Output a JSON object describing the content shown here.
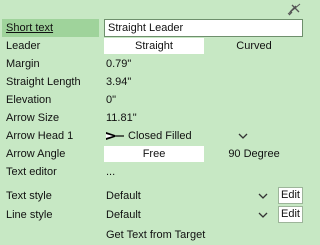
{
  "rows": {
    "short_text": {
      "label": "Short text",
      "value": "Straight Leader"
    },
    "leader": {
      "label": "Leader",
      "options": [
        "Straight",
        "Curved"
      ],
      "selected": "Straight"
    },
    "margin": {
      "label": "Margin",
      "value": "0.79\""
    },
    "straight_length": {
      "label": "Straight Length",
      "value": "3.94\""
    },
    "elevation": {
      "label": "Elevation",
      "value": "0\""
    },
    "arrow_size": {
      "label": "Arrow Size",
      "value": "11.81\""
    },
    "arrow_head": {
      "label": "Arrow Head 1",
      "value": "Closed Filled",
      "icon": "closed-filled-arrow-icon"
    },
    "arrow_angle": {
      "label": "Arrow Angle",
      "options": [
        "Free",
        "90 Degree"
      ],
      "selected": "Free"
    },
    "text_editor": {
      "label": "Text editor",
      "value": "..."
    },
    "text_style": {
      "label": "Text style",
      "value": "Default",
      "edit": "Edit"
    },
    "line_style": {
      "label": "Line style",
      "value": "Default",
      "edit": "Edit"
    },
    "get_text": {
      "button": "Get Text from Target"
    }
  },
  "colors": {
    "panel": "#c7e8c4",
    "selected": "#9fd39b",
    "field": "#ffffff"
  },
  "icons": {
    "pin": "pin-icon"
  }
}
